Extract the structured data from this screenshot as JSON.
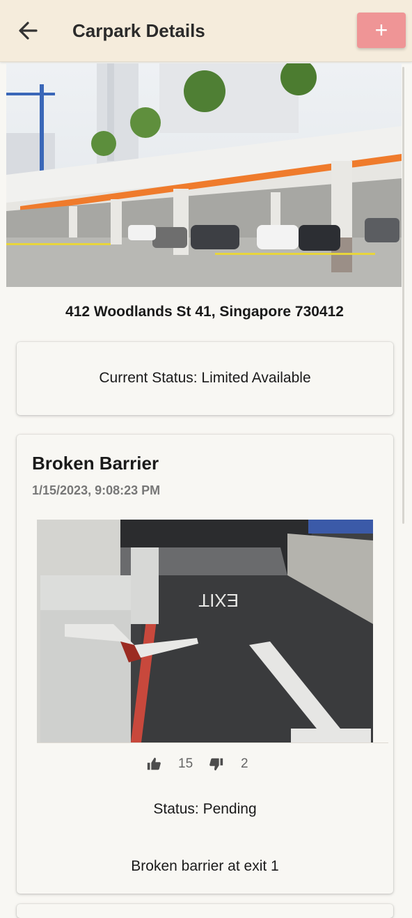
{
  "header": {
    "title": "Carpark Details",
    "add_label": "+"
  },
  "carpark": {
    "address": "412 Woodlands St 41, Singapore 730412",
    "status_text": "Current Status: Limited Available"
  },
  "reports": [
    {
      "title": "Broken Barrier",
      "timestamp": "1/15/2023, 9:08:23 PM",
      "upvotes": "15",
      "downvotes": "2",
      "status_text": "Status: Pending",
      "description": "Broken barrier at exit 1"
    }
  ],
  "colors": {
    "header_bg": "#f5ecdc",
    "add_button": "#ef9596",
    "page_bg": "#f8f7f3"
  },
  "icons": [
    "back-arrow-icon",
    "plus-icon",
    "thumbs-up-icon",
    "thumbs-down-icon"
  ]
}
